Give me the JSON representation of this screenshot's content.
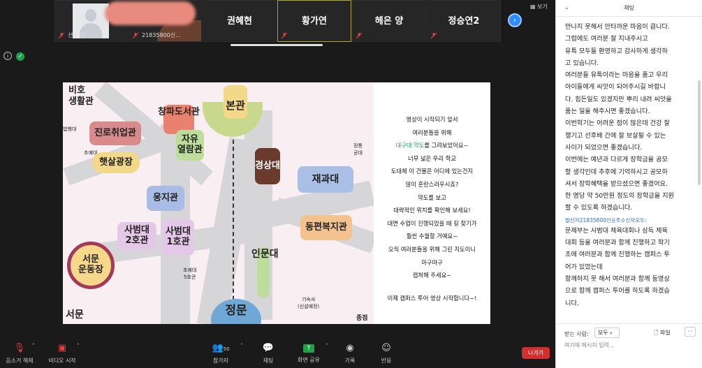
{
  "participants": [
    {
      "name": "선우 정"
    },
    {
      "name": "21835800신..."
    },
    {
      "name": "권혜현"
    },
    {
      "name": "황가연"
    },
    {
      "name": "헤은 양"
    },
    {
      "name": "정승연2"
    }
  ],
  "view_label": "보기",
  "next_icon": "chevron-right-icon",
  "map": {
    "labels": {
      "bibo": "비호",
      "life": "생활관",
      "bophae": "법행대",
      "career": "진로취업관",
      "choye": "초예대",
      "sunshine": "햇살광장",
      "changpa": "창파도서관",
      "main": "본관",
      "jayu": "자유\n열람관",
      "gyeongsang": "경상대",
      "jeongtong": "정통\n공대",
      "jaegwa": "재과대",
      "ungji": "웅지관",
      "sabeom2": "사범대\n2호관",
      "sabeom1": "사범대\n1호관",
      "dongpyeon": "동편복지관",
      "seomun_field": "서문\n운동장",
      "choye5": "초예대\n5호관",
      "inmun": "인문대",
      "dorm": "기숙사\n(신설예정)",
      "seomun": "서문",
      "jeongmun": "정문",
      "jongjeom": "종점"
    },
    "story": [
      "영상이 시작되기 앞서",
      "여러분들을 위해",
      "대구대 약도를 그려보았어요~",
      "너무 넓은 우리 학교",
      "도대체 이 건물은 어디에 있는건지",
      "많이 혼란스러우시죠?",
      "약도를 보고",
      "대략적인 위치를 확인해 보세요!",
      "대면 수업이 진행되었을 때 길 찾기가",
      "훨씬 수월할 거예요~",
      "오직 여러분들을 위해 그린 지도이니",
      "마구마구",
      "캡처해 주세요~",
      "이제 캠퍼스 투어 영상 시작합니다~!"
    ],
    "story_green": "대구대 약도"
  },
  "chat": {
    "title": "채팅",
    "lines": [
      "만나지 못해서 안타까운 마음이 큽니다.",
      "그럼에도 여러분 잘 지내주시고",
      "유특 모두들 환영하고 감사하게 생각하",
      "고 있습니다.",
      "여러분들 유특이라는 마음을 품고 우리",
      "아이들에게 씨앗이 되어주시길 바랍니",
      "다. 힘든일도 있겠지만 뿌리 내려 씨앗을",
      "품는 일을 해주시면 좋겠습니다.",
      "이번학기는 어려운 점이 많은데 건강 잘",
      "챙기고 선후배 간에 잘 보살필 수 있는",
      "사이가 되었으면 좋겠습니다.",
      "이번에는 예년과 다르게 장학금을 공모",
      "할 생각인데 추후에 기억하시고 공모하",
      "셔서 장학혜택을 받으셨으면 좋겠어요.",
      "한 명당 약 50만원 정도의 장학금을 지원",
      "할 수 있도록 하겠습니다."
    ],
    "sender": "발신자21835800신승주수신자모두:",
    "lines2": [
      "문제부는 사범대 체육대회나 삼득 체육",
      "대회 등을 여러분과 함께 진행하고 학기",
      "초에 여러분과 함께 진행하는 캠퍼스 투",
      "어가 있었는데",
      "함께하지 못 해서 여러분과 함께 동영상",
      "으로 함께 캠퍼스 투어를 하도록 하겠습",
      "니다."
    ],
    "to_label": "받는 사람:",
    "to_value": "모두",
    "file_label": "파일",
    "input_placeholder": "여기에 메시지 입력..."
  },
  "toolbar": {
    "unmute": "음소거 해제",
    "video": "비디오 시작",
    "participants": "참가자",
    "participants_count": "50",
    "chat": "채팅",
    "share": "화면 공유",
    "record": "기록",
    "reactions": "반응",
    "leave": "나가기"
  }
}
